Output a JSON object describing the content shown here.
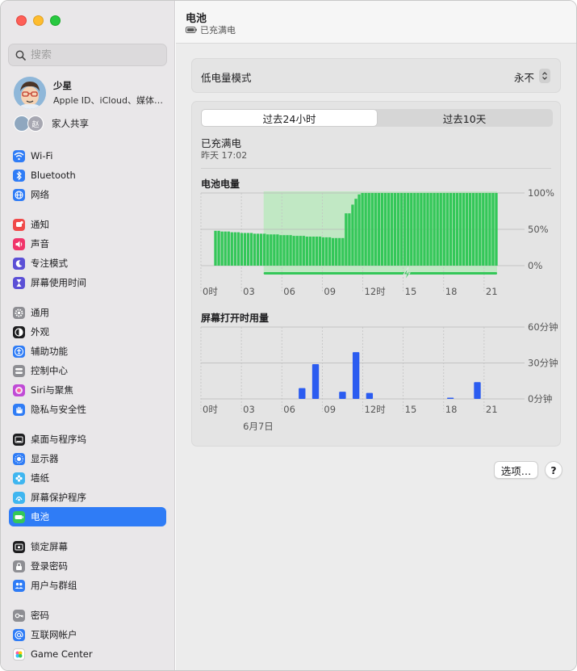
{
  "sidebar": {
    "search_placeholder": "搜索",
    "profile": {
      "name": "少星",
      "subtitle": "Apple ID、iCloud、媒体…"
    },
    "family": {
      "label": "家人共享",
      "badge": "赵"
    },
    "groups": [
      {
        "items": [
          {
            "label": "Wi-Fi",
            "icon": "wifi-icon",
            "color": "#2f7cf6"
          },
          {
            "label": "Bluetooth",
            "icon": "bluetooth-icon",
            "color": "#2f7cf6"
          },
          {
            "label": "网络",
            "icon": "globe-icon",
            "color": "#2f7cf6"
          }
        ]
      },
      {
        "items": [
          {
            "label": "通知",
            "icon": "bell-icon",
            "color": "#f04a4a"
          },
          {
            "label": "声音",
            "icon": "speaker-icon",
            "color": "#f0356a"
          },
          {
            "label": "专注模式",
            "icon": "moon-icon",
            "color": "#5b4fd6"
          },
          {
            "label": "屏幕使用时间",
            "icon": "hourglass-icon",
            "color": "#5b4fd6"
          }
        ]
      },
      {
        "items": [
          {
            "label": "通用",
            "icon": "gear-icon",
            "color": "#8e8e93"
          },
          {
            "label": "外观",
            "icon": "appearance-icon",
            "color": "#1d1d1f"
          },
          {
            "label": "辅助功能",
            "icon": "accessibility-icon",
            "color": "#2f7cf6"
          },
          {
            "label": "控制中心",
            "icon": "control-center-icon",
            "color": "#8e8e93"
          },
          {
            "label": "Siri与聚焦",
            "icon": "siri-icon",
            "color": "#c04ad6"
          },
          {
            "label": "隐私与安全性",
            "icon": "hand-icon",
            "color": "#2f7cf6"
          }
        ]
      },
      {
        "items": [
          {
            "label": "桌面与程序坞",
            "icon": "dock-icon",
            "color": "#1d1d1f"
          },
          {
            "label": "显示器",
            "icon": "sun-icon",
            "color": "#2f7cf6"
          },
          {
            "label": "墙纸",
            "icon": "flower-icon",
            "color": "#3fb6f0"
          },
          {
            "label": "屏幕保护程序",
            "icon": "screensaver-icon",
            "color": "#3fb6f0"
          },
          {
            "label": "电池",
            "icon": "battery-icon",
            "color": "#34c759",
            "active": true
          }
        ]
      },
      {
        "items": [
          {
            "label": "锁定屏幕",
            "icon": "lock-screen-icon",
            "color": "#1d1d1f"
          },
          {
            "label": "登录密码",
            "icon": "lock-icon",
            "color": "#8e8e93"
          },
          {
            "label": "用户与群组",
            "icon": "users-icon",
            "color": "#2f7cf6"
          }
        ]
      },
      {
        "items": [
          {
            "label": "密码",
            "icon": "key-icon",
            "color": "#8e8e93"
          },
          {
            "label": "互联网帐户",
            "icon": "at-icon",
            "color": "#2f7cf6"
          },
          {
            "label": "Game Center",
            "icon": "game-center-icon",
            "color": "#ffffff"
          }
        ]
      }
    ]
  },
  "header": {
    "title": "电池",
    "status": "已充满电"
  },
  "low_power": {
    "label": "低电量模式",
    "value": "永不"
  },
  "tabs": {
    "tab1": "过去24小时",
    "tab2": "过去10天"
  },
  "status": {
    "title": "已充满电",
    "time": "昨天 17:02"
  },
  "battery_section": {
    "title": "电池电量"
  },
  "screen_section": {
    "title": "屏幕打开时用量"
  },
  "buttons": {
    "options": "选项…",
    "help": "?"
  },
  "colors": {
    "battery_green": "#34c759",
    "charging_band": "#b6e9b9",
    "screen_blue": "#2b5cf0",
    "accent": "#2f7cf6"
  },
  "chart_data": [
    {
      "type": "bar",
      "title": "电池电量",
      "x_tick_labels": [
        "21",
        "0时",
        "03",
        "06",
        "09",
        "12时",
        "15",
        "18"
      ],
      "y_tick_labels": [
        "100%",
        "50%",
        "0%"
      ],
      "ylim": [
        0,
        100
      ],
      "charging_range": [
        15,
        41
      ],
      "values": [
        48,
        48,
        47,
        47,
        47,
        46,
        46,
        46,
        45,
        45,
        45,
        45,
        44,
        44,
        44,
        44,
        43,
        43,
        43,
        43,
        42,
        42,
        42,
        42,
        41,
        41,
        41,
        41,
        40,
        40,
        40,
        40,
        40,
        39,
        39,
        39,
        38,
        38,
        38,
        38,
        72,
        72,
        84,
        92,
        98,
        100,
        100,
        100,
        100,
        100,
        100,
        100,
        100,
        100,
        100,
        100,
        100,
        100,
        100,
        100,
        100,
        100,
        100,
        100,
        100,
        100,
        100,
        100,
        100,
        100,
        100,
        100,
        100,
        100,
        100,
        100,
        100,
        100,
        100,
        100,
        100,
        100,
        100,
        100,
        100,
        100,
        100
      ]
    },
    {
      "type": "bar",
      "title": "屏幕打开时用量",
      "x_tick_labels": [
        "21",
        "0时",
        "03",
        "06",
        "09",
        "12时",
        "15",
        "18"
      ],
      "x_date_label": "6月7日",
      "y_tick_labels": [
        "60分钟",
        "30分钟",
        "0分钟"
      ],
      "ylim": [
        0,
        60
      ],
      "hours": [
        4,
        5,
        7,
        8,
        9,
        15,
        17
      ],
      "values": [
        9,
        29,
        6,
        39,
        5,
        1,
        14
      ]
    }
  ]
}
